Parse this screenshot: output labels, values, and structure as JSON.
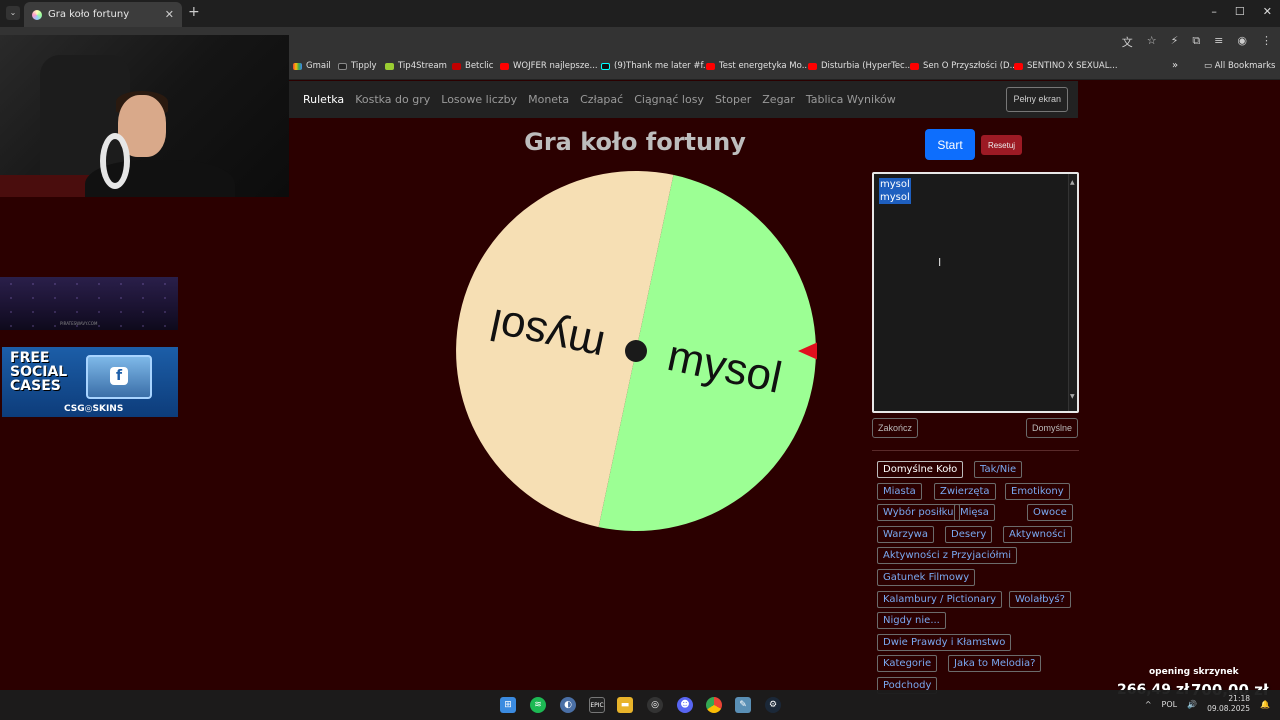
{
  "browser": {
    "tab_title": "Gra koło fortuny",
    "new_tab": "+",
    "win_min": "–",
    "win_max": "☐",
    "win_close": "✕",
    "tab_close": "✕",
    "tab_menu": "⌄"
  },
  "bookmarks": {
    "items": [
      {
        "label": "Gmail",
        "icon": "gmail"
      },
      {
        "label": "Tipply",
        "icon": "tip"
      },
      {
        "label": "Tip4Stream",
        "icon": "green"
      },
      {
        "label": "Betclic",
        "icon": "betclic"
      },
      {
        "label": "WOJFER najlepsze...",
        "icon": "red"
      },
      {
        "label": "(9)Thank me later #f...",
        "icon": "tiktok"
      },
      {
        "label": "Test energetyka Mo...",
        "icon": "red"
      },
      {
        "label": "Disturbia (HyperTec...",
        "icon": "red"
      },
      {
        "label": "Sen O Przyszłości (D...",
        "icon": "red"
      },
      {
        "label": "SENTINO X SEXUAL...",
        "icon": "red"
      }
    ],
    "more": "»",
    "all_bookmarks": "All Bookmarks"
  },
  "ads": {
    "ad1_caption": "PIRATESWAVY.COM",
    "ad2_free": "FREE",
    "ad2_social": "SOCIAL",
    "ad2_cases": "CASES",
    "ad2_brand": "CSG◎SKINS",
    "ad2_fb": "f"
  },
  "nav": {
    "items": [
      "Ruletka",
      "Kostka do gry",
      "Losowe liczby",
      "Moneta",
      "Człapać",
      "Ciągnąć losy",
      "Stoper",
      "Zegar",
      "Tablica Wyników"
    ],
    "active": "Ruletka",
    "fullscreen": "Pełny ekran"
  },
  "game": {
    "title": "Gra koło fortuny",
    "start": "Start",
    "reset": "Resetuj",
    "entries": [
      "mysol",
      "mysol"
    ],
    "finish": "Zakończ",
    "default": "Domyślne"
  },
  "wheel": {
    "segments": [
      {
        "label": "mysol",
        "color": "#9cff94",
        "share": 0.5
      },
      {
        "label": "mysol",
        "color": "#f6dfb4",
        "share": 0.5
      }
    ],
    "pointer_color": "#e0101e",
    "hub_color": "#1a1a1a"
  },
  "presets": [
    "Domyślne Koło",
    "Tak/Nie",
    "Miasta",
    "Zwierzęta",
    "Emotikony",
    "Wybór posiłku",
    "Mięsa",
    "Owoce",
    "Warzywa",
    "Desery",
    "Aktywności",
    "Aktywności z Przyjaciółmi",
    "Gatunek Filmowy",
    "Kalambury / Pictionary",
    "Wolałbyś?",
    "Nigdy nie...",
    "Dwie Prawdy i Kłamstwo",
    "Kategorie",
    "Jaka to Melodia?",
    "Podchody"
  ],
  "overlay": {
    "label": "opening skrzynek",
    "amount1": "266,49 zł",
    "amount2": "700,00 zł"
  },
  "taskbar": {
    "time": "21:18",
    "date": "09.08.2025",
    "lang": "POL"
  },
  "colors": {
    "background": "#2b0000",
    "accent": "#0d6efd",
    "reset": "#9c1a24",
    "preset_link": "#7aa8f0"
  }
}
